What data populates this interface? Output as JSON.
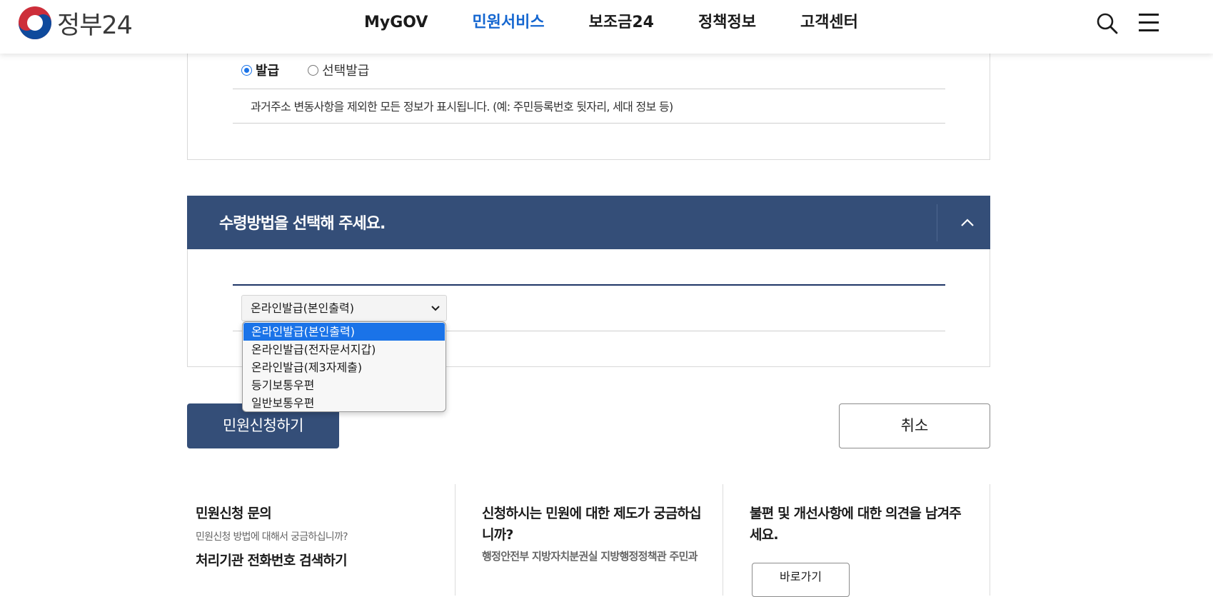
{
  "header": {
    "logo_text": "정부24",
    "nav": [
      "MyGOV",
      "민원서비스",
      "보조금24",
      "정책정보",
      "고객센터"
    ],
    "active_nav": "민원서비스"
  },
  "issuance": {
    "options": [
      "발급",
      "선택발급"
    ],
    "selected": "발급",
    "description": "과거주소 변동사항을 제외한 모든 정보가 표시됩니다. (예: 주민등록번호 뒷자리, 세대 정보 등)"
  },
  "receipt": {
    "title": "수령방법을 선택해 주세요.",
    "selected_value": "온라인발급(본인출력)",
    "options": [
      "온라인발급(본인출력)",
      "온라인발급(전자문서지갑)",
      "온라인발급(제3자제출)",
      "등기보통우편",
      "일반보통우편"
    ]
  },
  "actions": {
    "apply_label": "민원신청하기",
    "cancel_label": "취소"
  },
  "info": {
    "col1": {
      "title": "민원신청 문의",
      "sub": "민원신청 방법에 대해서 궁금하십니까?",
      "link": "처리기관 전화번호 검색하기"
    },
    "col2": {
      "title": "신청하시는 민원에 대한 제도가 궁금하십니까?",
      "dept": "행정안전부 지방자치분권실 지방행정정책관 주민과"
    },
    "col3": {
      "title": "불편 및 개선사항에 대한 의견을 남겨주세요.",
      "button": "바로가기"
    }
  },
  "colors": {
    "primary_navy": "#344e78",
    "active_nav": "#1466d0",
    "select_highlight": "#1a73e8"
  }
}
